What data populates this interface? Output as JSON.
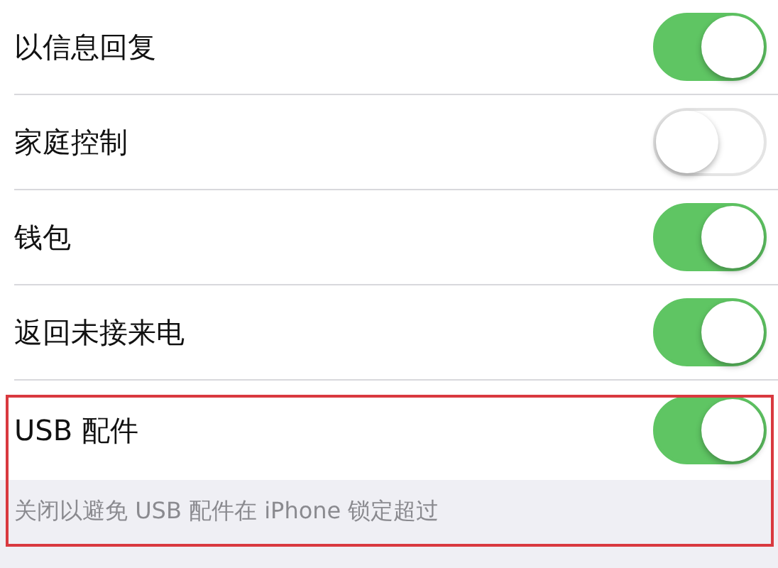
{
  "rows": [
    {
      "label": "以信息回复",
      "on": true,
      "highlighted": false
    },
    {
      "label": "家庭控制",
      "on": false,
      "highlighted": false
    },
    {
      "label": "钱包",
      "on": true,
      "highlighted": false
    },
    {
      "label": "返回未接来电",
      "on": true,
      "highlighted": false
    },
    {
      "label": "USB 配件",
      "on": true,
      "highlighted": true
    }
  ],
  "footer": {
    "text": "关闭以避免 USB 配件在 iPhone 锁定超过",
    "highlighted": true
  }
}
